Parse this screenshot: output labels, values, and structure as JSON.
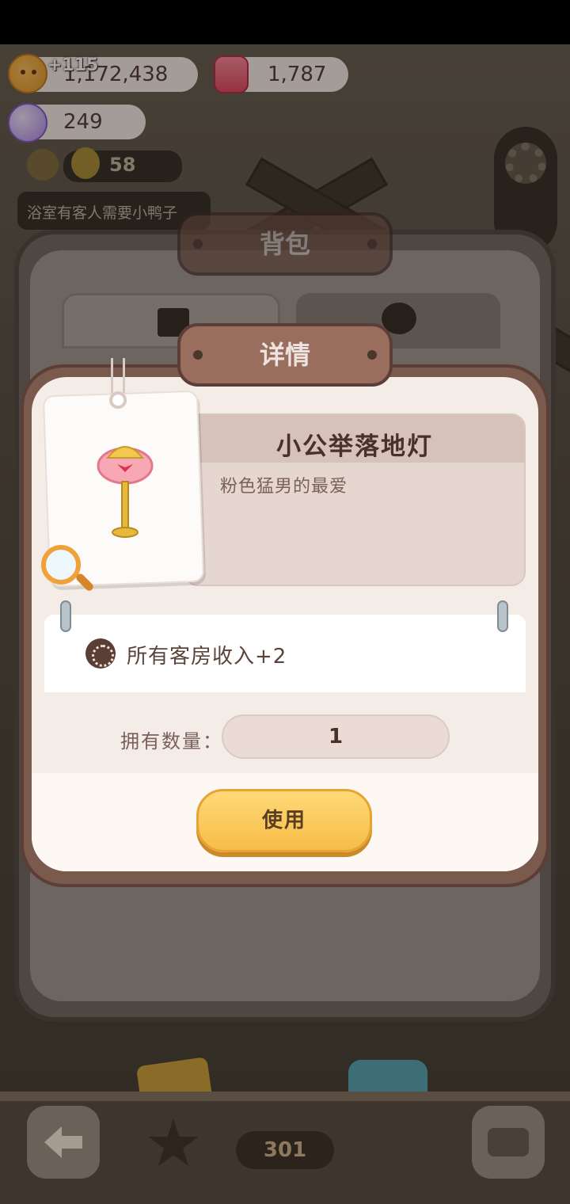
{
  "currency": {
    "cookies": "1,172,438",
    "cookie_gain": "+115",
    "jam": "1,787",
    "gems": "249"
  },
  "hud": {
    "duck_count": "58",
    "notice": "浴室有客人需要小鸭子"
  },
  "bag": {
    "title": "背包"
  },
  "detail": {
    "title": "详情",
    "item_name": "小公举落地灯",
    "item_desc": "粉色猛男的最爱",
    "effect": "所有客房收入+2",
    "qty_label": "拥有数量：",
    "qty_value": "1",
    "use_button": "使用"
  },
  "bottom": {
    "counter": "301"
  },
  "icons": [
    "cookie-icon",
    "jam-icon",
    "gem-icon",
    "bell-icon",
    "duck-icon",
    "gear-icon",
    "box-icon",
    "bag-tab-icon",
    "magnifier-icon",
    "cookie-small-icon",
    "back-arrow-icon",
    "star-icon",
    "sofa-icon"
  ]
}
